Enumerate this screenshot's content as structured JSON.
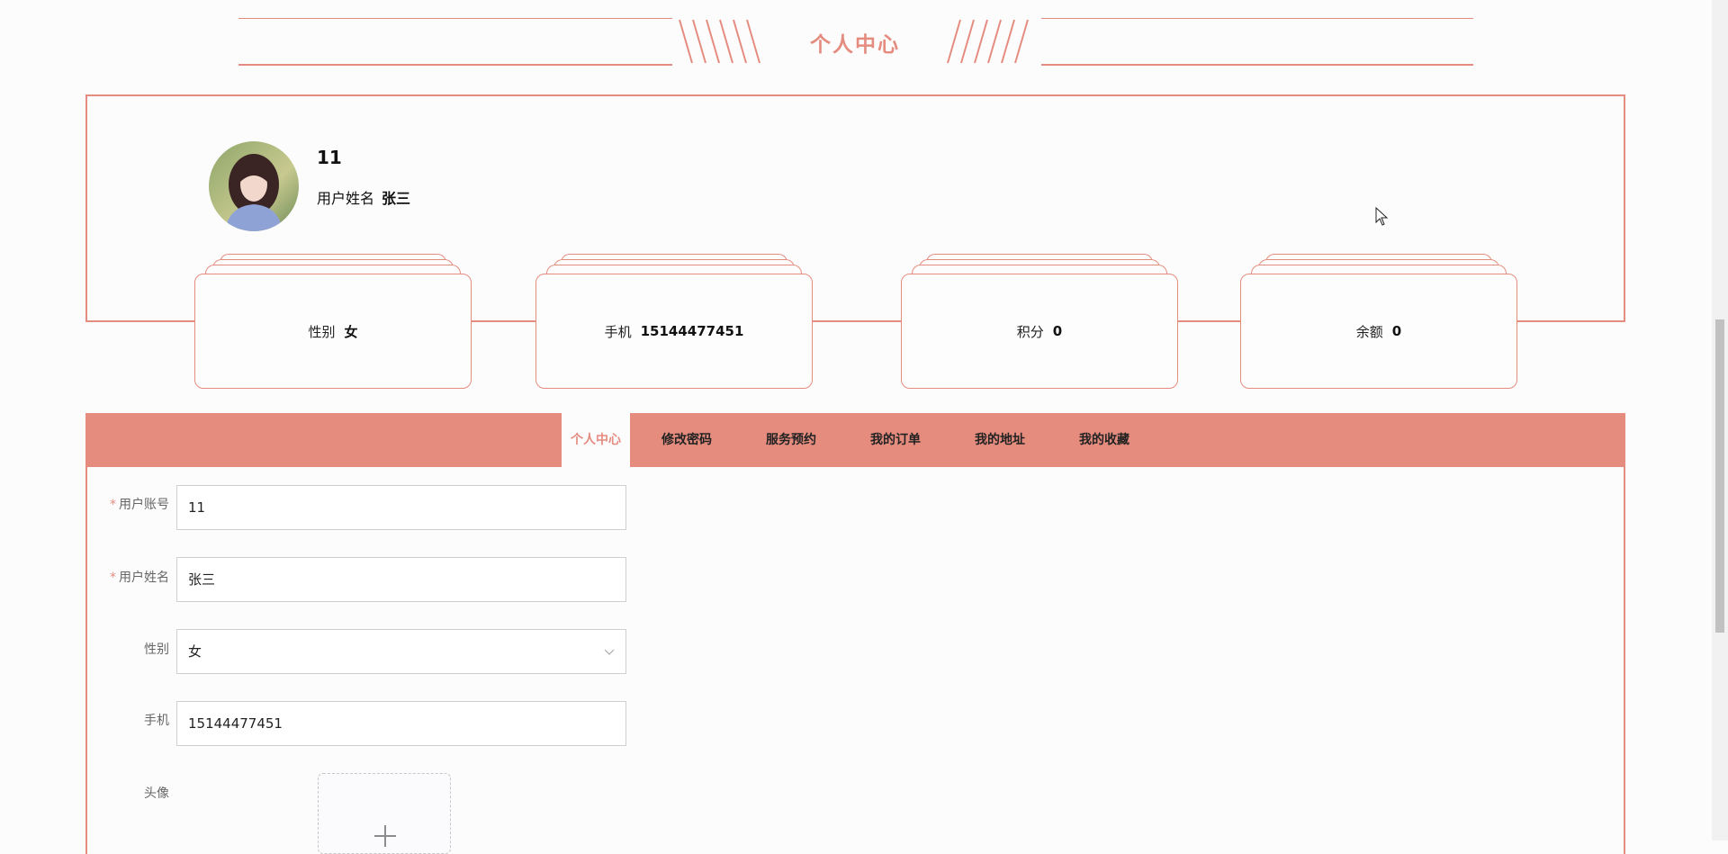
{
  "header": {
    "title": "个人中心"
  },
  "profile": {
    "account": "11",
    "name_label": "用户姓名",
    "name_value": "张三"
  },
  "stats": [
    {
      "label": "性别",
      "value": "女"
    },
    {
      "label": "手机",
      "value": "15144477451"
    },
    {
      "label": "积分",
      "value": "0"
    },
    {
      "label": "余额",
      "value": "0"
    }
  ],
  "tabs": [
    {
      "label": "个人中心",
      "active": true
    },
    {
      "label": "修改密码"
    },
    {
      "label": "服务预约"
    },
    {
      "label": "我的订单"
    },
    {
      "label": "我的地址"
    },
    {
      "label": "我的收藏"
    }
  ],
  "form": {
    "account": {
      "label": "用户账号",
      "value": "11",
      "required": true
    },
    "name": {
      "label": "用户姓名",
      "value": "张三",
      "required": true
    },
    "gender": {
      "label": "性别",
      "value": "女"
    },
    "phone": {
      "label": "手机",
      "value": "15144477451"
    },
    "avatar": {
      "label": "头像"
    }
  },
  "colors": {
    "accent": "#e58c80",
    "tabbar": "#e58c7e"
  },
  "icons": [
    "chevron-down-icon",
    "plus-icon",
    "mouse-cursor-icon"
  ]
}
